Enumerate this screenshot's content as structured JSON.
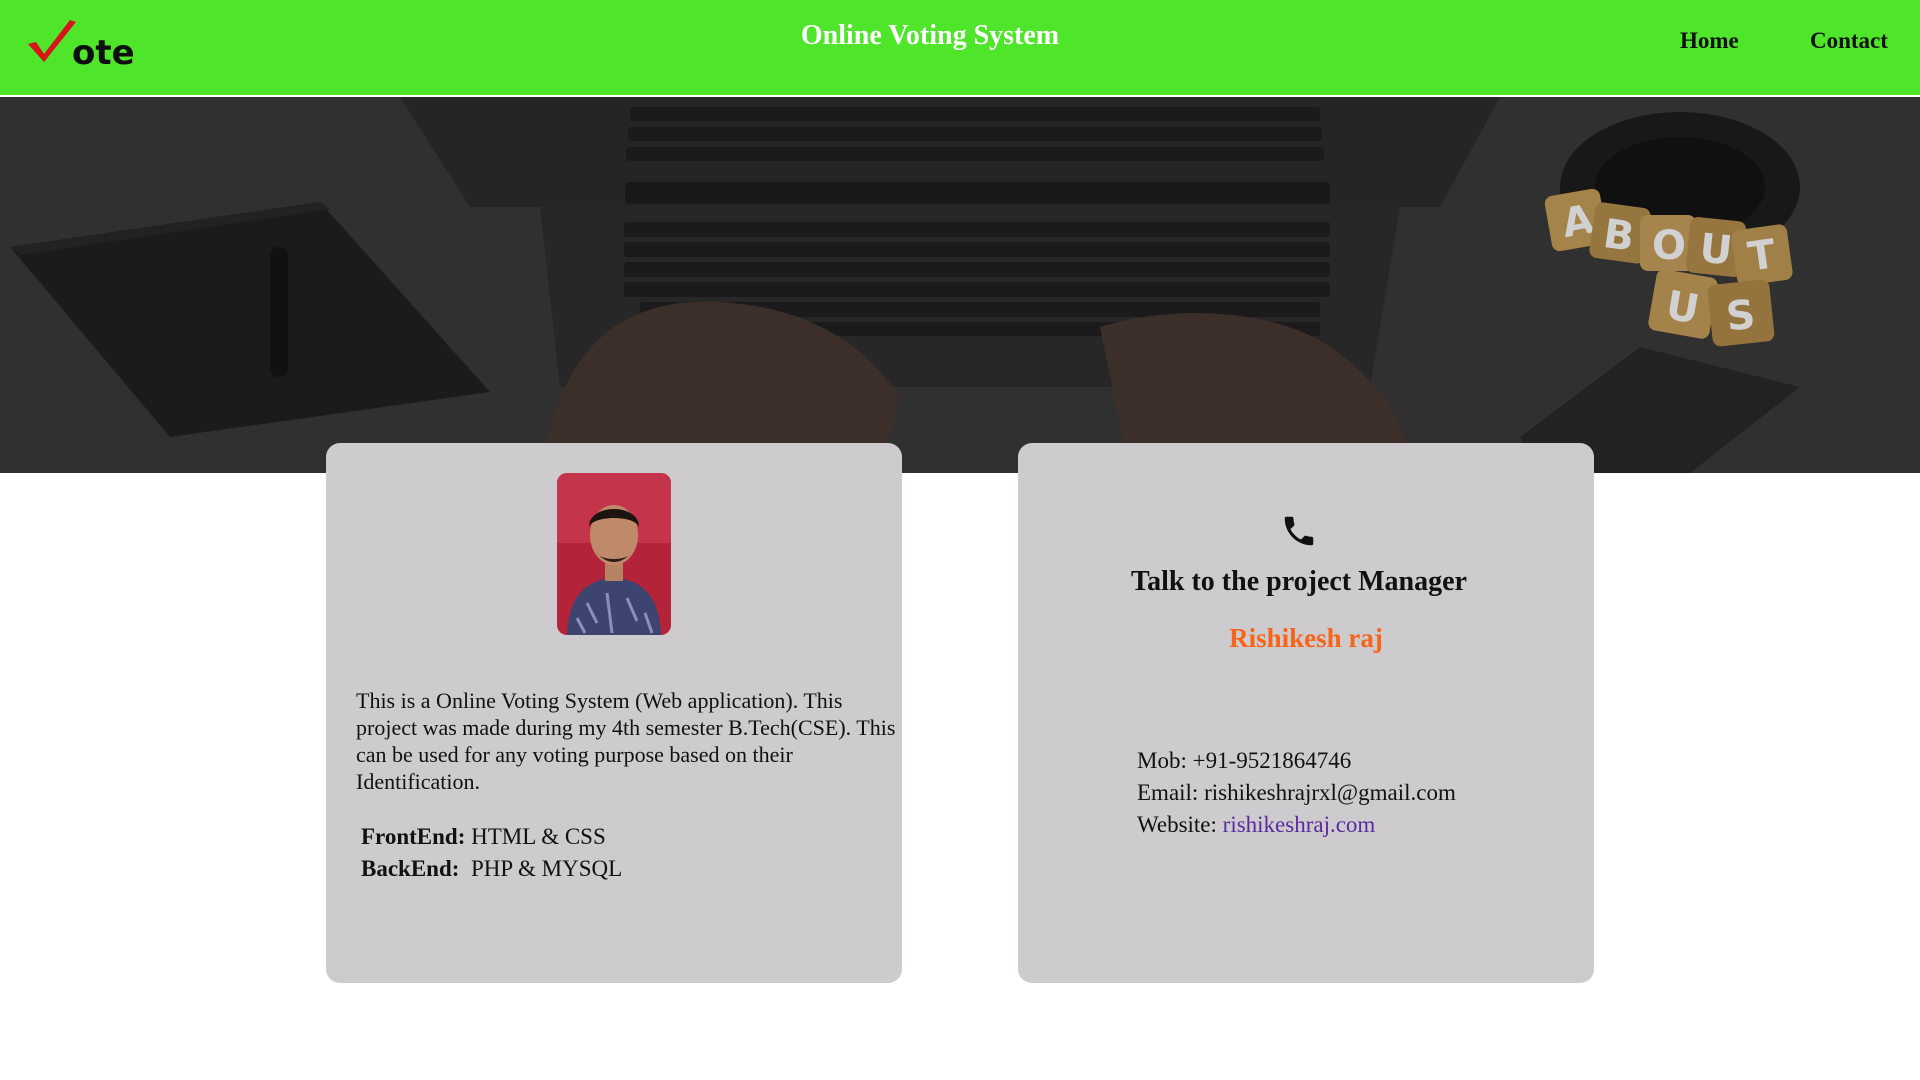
{
  "header": {
    "logo_text": "Vote",
    "title": "Online Voting System",
    "nav": {
      "home": "Home",
      "contact": "Contact"
    }
  },
  "banner": {
    "image": "laptop-keyboard-hands-photo",
    "badge_text": "ABOUT US"
  },
  "about_card": {
    "photo": "profile-photo",
    "description": "This is a Online Voting System (Web application). This project was made during my 4th semester B.Tech(CSE). This can be used for any voting purpose based on their Identification.",
    "frontend_label": "FrontEnd:",
    "frontend_value": "HTML & CSS",
    "backend_label": "BackEnd:",
    "backend_value": "PHP & MYSQL"
  },
  "contact_card": {
    "icon": "phone-icon",
    "heading": "Talk to the project Manager",
    "name": "Rishikesh raj",
    "mob_label": "Mob:",
    "mob_value": "+91-9521864746",
    "email_label": "Email:",
    "email_value": "rishikeshrajrxl@gmail.com",
    "website_label": "Website:",
    "website_value": "rishikeshraj.com"
  },
  "colors": {
    "header_bg": "#4ee52a",
    "card_bg": "#cdcbcd",
    "accent_name": "#f7651b",
    "link": "#5b2aa0"
  }
}
